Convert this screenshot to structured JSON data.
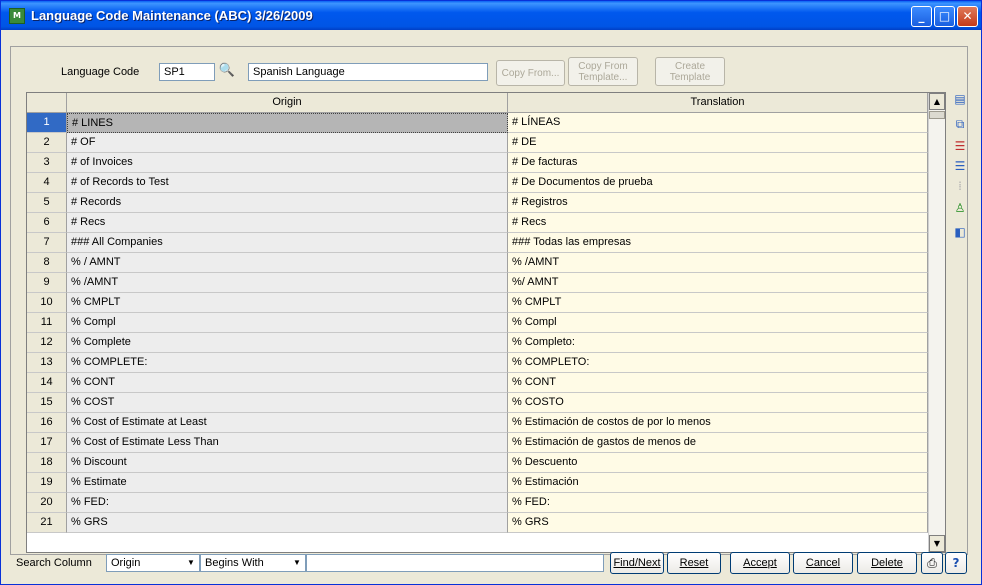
{
  "window": {
    "title": "Language Code Maintenance (ABC) 3/26/2009",
    "app_icon": "sage-mas-icon",
    "buttons": [
      "minimize",
      "maximize",
      "close"
    ]
  },
  "header": {
    "language_code_label": "Language Code",
    "language_code_value": "SP1",
    "language_name": "Spanish Language",
    "copy_from_label": "Copy From...",
    "copy_from_template_label_1": "Copy From",
    "copy_from_template_label_2": "Template...",
    "create_template_label_1": "Create",
    "create_template_label_2": "Template"
  },
  "grid": {
    "columns": [
      "Origin",
      "Translation"
    ],
    "rows": [
      {
        "n": "1",
        "origin": "# LINES",
        "translation": "# LÍNEAS"
      },
      {
        "n": "2",
        "origin": "# OF",
        "translation": "# DE"
      },
      {
        "n": "3",
        "origin": "# of Invoices",
        "translation": "# De facturas"
      },
      {
        "n": "4",
        "origin": "# of Records to Test",
        "translation": "# De Documentos de prueba"
      },
      {
        "n": "5",
        "origin": "# Records",
        "translation": "# Registros"
      },
      {
        "n": "6",
        "origin": "# Recs",
        "translation": "# Recs"
      },
      {
        "n": "7",
        "origin": "### All Companies",
        "translation": "### Todas las empresas"
      },
      {
        "n": "8",
        "origin": "% / AMNT",
        "translation": "% /AMNT"
      },
      {
        "n": "9",
        "origin": "% /AMNT",
        "translation": "%/ AMNT"
      },
      {
        "n": "10",
        "origin": "% CMPLT",
        "translation": "% CMPLT"
      },
      {
        "n": "11",
        "origin": "% Compl",
        "translation": "% Compl"
      },
      {
        "n": "12",
        "origin": "% Complete",
        "translation": "% Completo:"
      },
      {
        "n": "13",
        "origin": "% COMPLETE:",
        "translation": "% COMPLETO:"
      },
      {
        "n": "14",
        "origin": "% CONT",
        "translation": "% CONT"
      },
      {
        "n": "15",
        "origin": "% COST",
        "translation": "% COSTO"
      },
      {
        "n": "16",
        "origin": "% Cost of Estimate at Least",
        "translation": "% Estimación de costos de por lo menos"
      },
      {
        "n": "17",
        "origin": "% Cost of Estimate Less Than",
        "translation": "% Estimación de gastos de menos de"
      },
      {
        "n": "18",
        "origin": "% Discount",
        "translation": "% Descuento"
      },
      {
        "n": "19",
        "origin": "% Estimate",
        "translation": "% Estimación"
      },
      {
        "n": "20",
        "origin": "% FED:",
        "translation": "% FED:"
      },
      {
        "n": "21",
        "origin": "% GRS",
        "translation": "% GRS"
      }
    ],
    "selected_row": 1
  },
  "side_toolbar": [
    "insert-row-icon",
    "copy-rows-icon",
    "delete-row-icon",
    "move-row-icon",
    "column-settings-icon",
    "user-arrow-icon",
    "export-icon"
  ],
  "footer": {
    "search_column_label": "Search Column",
    "search_column_value": "Origin",
    "search_mode_value": "Begins With",
    "search_text": "",
    "find_next": "Find/Next",
    "reset": "Reset",
    "accept": "Accept",
    "cancel": "Cancel",
    "delete": "Delete"
  }
}
